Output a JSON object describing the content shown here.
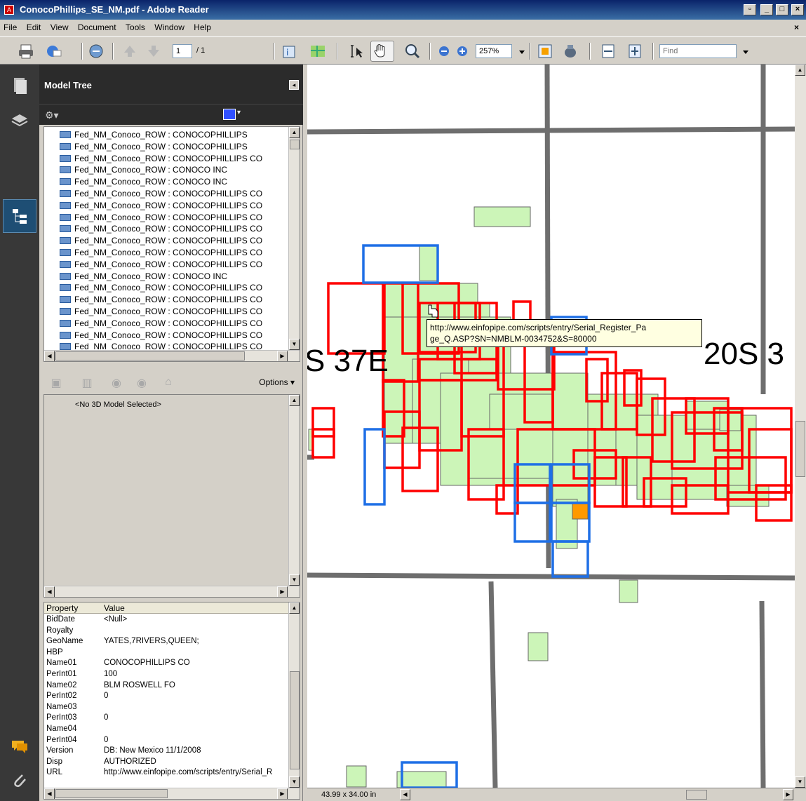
{
  "window": {
    "title": "ConocoPhillips_SE_NM.pdf - Adobe Reader"
  },
  "menu": [
    "File",
    "Edit",
    "View",
    "Document",
    "Tools",
    "Window",
    "Help"
  ],
  "toolbar": {
    "page_current": "1",
    "page_total": "/ 1",
    "zoom": "257%",
    "find_placeholder": "Find"
  },
  "panel": {
    "title": "Model Tree",
    "tree_items": [
      "Fed_NM_Conoco_ROW : CONOCOPHILLIPS",
      "Fed_NM_Conoco_ROW : CONOCOPHILLIPS",
      "Fed_NM_Conoco_ROW : CONOCOPHILLIPS CO",
      "Fed_NM_Conoco_ROW : CONOCO INC",
      "Fed_NM_Conoco_ROW : CONOCO INC",
      "Fed_NM_Conoco_ROW : CONOCOPHILLIPS CO",
      "Fed_NM_Conoco_ROW : CONOCOPHILLIPS CO",
      "Fed_NM_Conoco_ROW : CONOCOPHILLIPS CO",
      "Fed_NM_Conoco_ROW : CONOCOPHILLIPS CO",
      "Fed_NM_Conoco_ROW : CONOCOPHILLIPS CO",
      "Fed_NM_Conoco_ROW : CONOCOPHILLIPS CO",
      "Fed_NM_Conoco_ROW : CONOCOPHILLIPS CO",
      "Fed_NM_Conoco_ROW : CONOCO INC",
      "Fed_NM_Conoco_ROW : CONOCOPHILLIPS CO",
      "Fed_NM_Conoco_ROW : CONOCOPHILLIPS CO",
      "Fed_NM_Conoco_ROW : CONOCOPHILLIPS CO",
      "Fed_NM_Conoco_ROW : CONOCOPHILLIPS CO",
      "Fed_NM_Conoco_ROW : CONOCOPHILLIPS CO",
      "Fed_NM_Conoco_ROW : CONOCOPHILLIPS CO"
    ],
    "options_label": "Options",
    "no_model_text": "<No 3D Model Selected>",
    "property_header": "Property",
    "value_header": "Value",
    "properties": [
      {
        "key": "BidDate",
        "value": "<Null>"
      },
      {
        "key": "Royalty",
        "value": ""
      },
      {
        "key": "GeoName",
        "value": "YATES,7RIVERS,QUEEN;"
      },
      {
        "key": "HBP",
        "value": ""
      },
      {
        "key": "Name01",
        "value": "CONOCOPHILLIPS CO"
      },
      {
        "key": "PerInt01",
        "value": "100"
      },
      {
        "key": "Name02",
        "value": "BLM ROSWELL FO"
      },
      {
        "key": "PerInt02",
        "value": "0"
      },
      {
        "key": "Name03",
        "value": ""
      },
      {
        "key": "PerInt03",
        "value": "0"
      },
      {
        "key": "Name04",
        "value": ""
      },
      {
        "key": "PerInt04",
        "value": "0"
      },
      {
        "key": "Version",
        "value": "DB: New Mexico 11/1/2008"
      },
      {
        "key": "Disp",
        "value": "AUTHORIZED"
      },
      {
        "key": "URL",
        "value": "http://www.einfopipe.com/scripts/entry/Serial_R"
      }
    ]
  },
  "map": {
    "label_left": "S 37E",
    "label_right": "20S 3",
    "tooltip_line1": "http://www.einfopipe.com/scripts/entry/Serial_Register_Pa",
    "tooltip_line2": "ge_Q.ASP?SN=NMBLM-0034752&S=80000",
    "page_size": "43.99 x 34.00 in"
  },
  "colors": {
    "parcel_fill": "#ccf5b8",
    "red_outline": "#ff0000",
    "blue_outline": "#1e6fe6",
    "orange_fill": "#ff9900",
    "road_gray": "#6e6e6e"
  }
}
